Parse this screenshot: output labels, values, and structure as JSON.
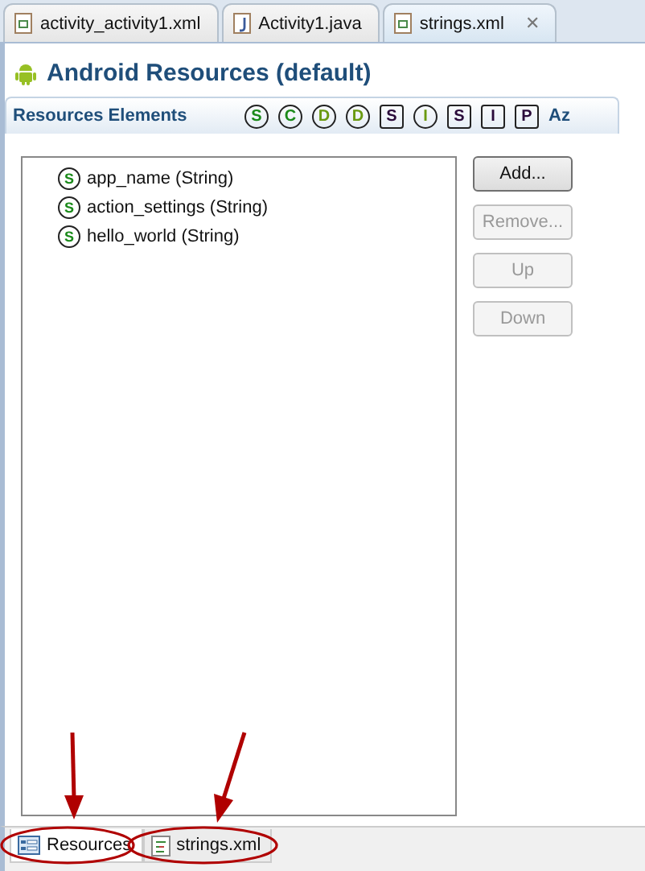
{
  "editor_tabs": [
    {
      "label": "activity_activity1.xml",
      "kind": "xml",
      "selected": false
    },
    {
      "label": "Activity1.java",
      "kind": "java",
      "selected": false
    },
    {
      "label": "strings.xml",
      "kind": "xml",
      "selected": true,
      "close": "✕"
    }
  ],
  "title": "Android Resources (default)",
  "section": {
    "title": "Resources Elements",
    "filters": [
      {
        "kind": "round",
        "text": "S",
        "color": "#1a8a1a"
      },
      {
        "kind": "round",
        "text": "C",
        "color": "#1a8a1a"
      },
      {
        "kind": "round",
        "text": "D",
        "color": "#6a9a10"
      },
      {
        "kind": "round",
        "text": "D",
        "color": "#6a9a10"
      },
      {
        "kind": "square",
        "text": "S",
        "color": "#2a0a3a"
      },
      {
        "kind": "round",
        "text": "I",
        "color": "#6a9a10"
      },
      {
        "kind": "square",
        "text": "S",
        "color": "#2a0a3a"
      },
      {
        "kind": "square",
        "text": "I",
        "color": "#2a0a3a"
      },
      {
        "kind": "square",
        "text": "P",
        "color": "#2a0a3a"
      },
      {
        "kind": "plain",
        "text": "Az",
        "color": "#1f4e7a"
      }
    ]
  },
  "resources": [
    {
      "icon": "S",
      "label": "app_name (String)"
    },
    {
      "icon": "S",
      "label": "action_settings (String)"
    },
    {
      "icon": "S",
      "label": "hello_world (String)"
    }
  ],
  "buttons": [
    {
      "label": "Add...",
      "disabled": false
    },
    {
      "label": "Remove...",
      "disabled": true
    },
    {
      "label": "Up",
      "disabled": true
    },
    {
      "label": "Down",
      "disabled": true
    }
  ],
  "bottom_tabs": [
    {
      "label": "Resources",
      "kind": "form",
      "selected": true
    },
    {
      "label": "strings.xml",
      "kind": "source",
      "selected": false
    }
  ]
}
